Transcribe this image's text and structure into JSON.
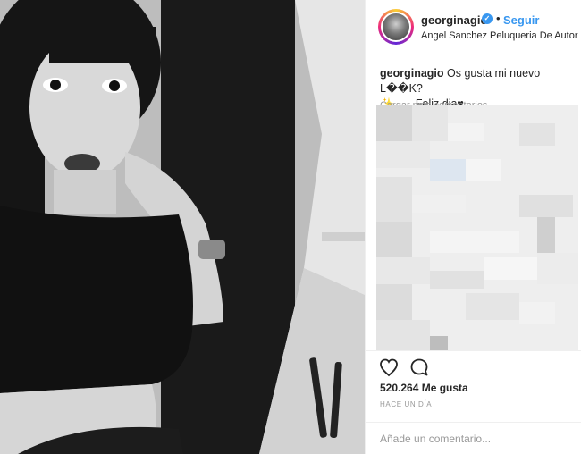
{
  "post": {
    "photo_icon": "photo-image"
  },
  "header": {
    "username": "georginagio",
    "verified_icon": "verified-badge-icon",
    "separator": "•",
    "follow_label": "Seguir",
    "location": "Angel Sanchez Peluqueria De Autor"
  },
  "caption": {
    "username": "georginagio",
    "text": "Os gusta mi nuevo L��K?",
    "line2": "✨...... Feliz dia♥"
  },
  "comments": {
    "load_more": "Cargar más comentarios"
  },
  "actions": {
    "like_icon": "heart-icon",
    "comment_icon": "comment-icon",
    "likes": "520.264 Me gusta",
    "time": "HACE UN DÍA"
  },
  "add_comment": {
    "placeholder": "Añade un comentario..."
  },
  "colors": {
    "accent": "#3897f0",
    "text": "#262626",
    "muted": "#999999",
    "border": "#efefef"
  }
}
